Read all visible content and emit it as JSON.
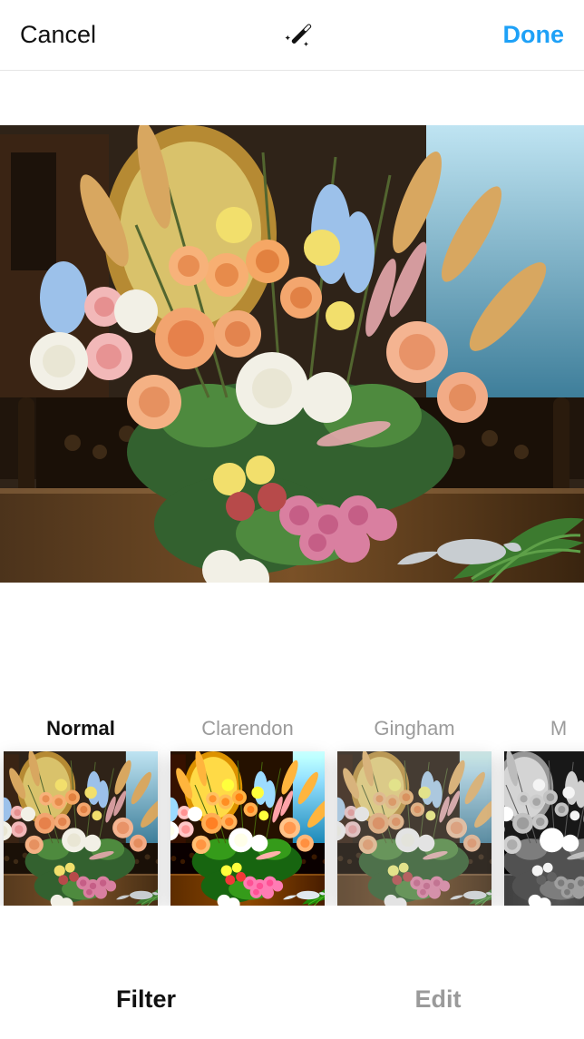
{
  "header": {
    "cancel": "Cancel",
    "done": "Done"
  },
  "filters": [
    {
      "label": "Normal",
      "selected": true,
      "effect": ""
    },
    {
      "label": "Clarendon",
      "selected": false,
      "effect": "f-clarendon"
    },
    {
      "label": "Gingham",
      "selected": false,
      "effect": "f-gingham"
    },
    {
      "label": "M",
      "selected": false,
      "effect": "f-moon",
      "partial": true
    }
  ],
  "tabs": {
    "filter": "Filter",
    "edit": "Edit",
    "active": "filter"
  }
}
